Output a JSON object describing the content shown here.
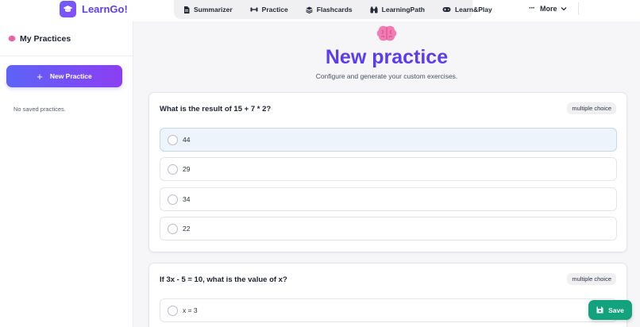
{
  "brand": {
    "name": "LearnGo!"
  },
  "nav": {
    "items": [
      {
        "label": "Summarizer",
        "icon": "document-icon"
      },
      {
        "label": "Practice",
        "icon": "dumbbell-icon"
      },
      {
        "label": "Flashcards",
        "icon": "stack-icon"
      },
      {
        "label": "LearningPath",
        "icon": "binoculars-icon"
      },
      {
        "label": "Learn&Play",
        "icon": "gamepad-icon"
      }
    ],
    "more_label": "More"
  },
  "sidebar": {
    "title": "My Practices",
    "new_button_label": "New Practice",
    "empty_text": "No saved practices."
  },
  "hero": {
    "title": "New practice",
    "subtitle": "Configure and generate your custom exercises."
  },
  "questions": [
    {
      "text": "What is the result of 15 + 7 * 2?",
      "badge": "multiple choice",
      "options": [
        "44",
        "29",
        "34",
        "22"
      ],
      "selected_index": 0
    },
    {
      "text": "If 3x - 5 = 10, what is the value of x?",
      "badge": "multiple choice",
      "options": [
        "x = 3"
      ]
    }
  ],
  "save_label": "Save",
  "colors": {
    "accent": "#5d3cee",
    "button_gradient_start": "#5d63f7",
    "button_gradient_end": "#8b3ff2",
    "save": "#12a37c",
    "selected_option_bg": "#eef4fc"
  }
}
